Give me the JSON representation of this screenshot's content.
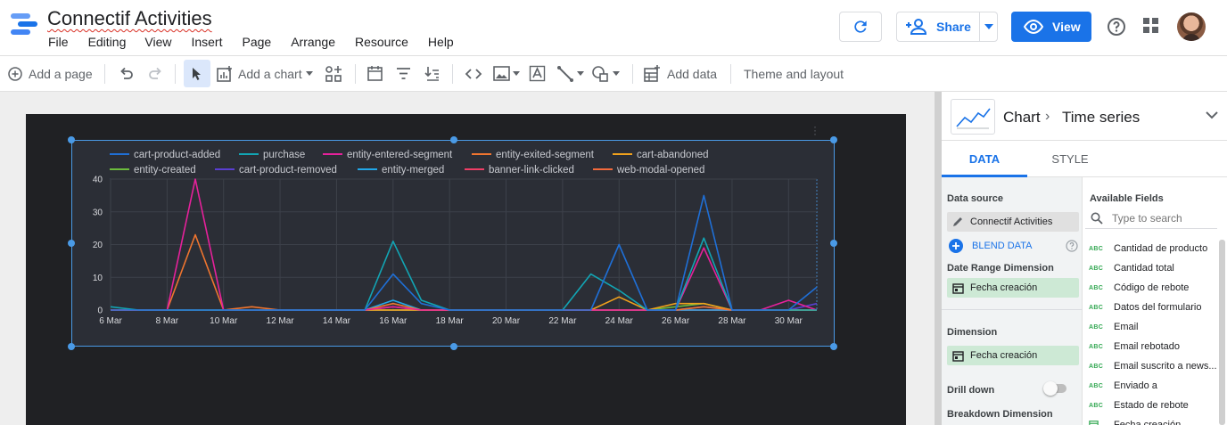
{
  "app": {
    "title": "Connectif Activities",
    "menu": [
      "File",
      "Editing",
      "View",
      "Insert",
      "Page",
      "Arrange",
      "Resource",
      "Help"
    ],
    "share_label": "Share",
    "view_label": "View",
    "brand_color": "#1a73e8"
  },
  "toolbar": {
    "add_page": "Add a page",
    "add_chart": "Add a chart",
    "add_data": "Add data",
    "theme_layout": "Theme and layout"
  },
  "panel": {
    "chart_label": "Chart",
    "chart_type": "Time series",
    "tabs": [
      "DATA",
      "STYLE"
    ],
    "data_source_label": "Data source",
    "data_source": "Connectif Activities",
    "blend_data": "BLEND DATA",
    "date_range_label": "Date Range Dimension",
    "date_range_value": "Fecha creación",
    "dimension_label": "Dimension",
    "dimension_value": "Fecha creación",
    "drill_down_label": "Drill down",
    "drill_down_on": false,
    "breakdown_label": "Breakdown Dimension",
    "available_fields_label": "Available Fields",
    "search_placeholder": "Type to search",
    "fields": [
      {
        "type": "ABC",
        "name": "Cantidad de producto"
      },
      {
        "type": "ABC",
        "name": "Cantidad total"
      },
      {
        "type": "ABC",
        "name": "Código de rebote"
      },
      {
        "type": "ABC",
        "name": "Datos del formulario"
      },
      {
        "type": "ABC",
        "name": "Email"
      },
      {
        "type": "ABC",
        "name": "Email rebotado"
      },
      {
        "type": "ABC",
        "name": "Email suscrito a news..."
      },
      {
        "type": "ABC",
        "name": "Enviado a"
      },
      {
        "type": "ABC",
        "name": "Estado de rebote"
      },
      {
        "type": "date",
        "name": "Fecha creación"
      }
    ]
  },
  "chart_data": {
    "type": "line",
    "x": [
      "6 Mar",
      "7 Mar",
      "8 Mar",
      "9 Mar",
      "10 Mar",
      "11 Mar",
      "12 Mar",
      "13 Mar",
      "14 Mar",
      "15 Mar",
      "16 Mar",
      "17 Mar",
      "18 Mar",
      "19 Mar",
      "20 Mar",
      "21 Mar",
      "22 Mar",
      "23 Mar",
      "24 Mar",
      "25 Mar",
      "26 Mar",
      "27 Mar",
      "28 Mar",
      "29 Mar",
      "30 Mar",
      "31 Mar"
    ],
    "x_tick_labels": [
      "6 Mar",
      "8 Mar",
      "10 Mar",
      "12 Mar",
      "14 Mar",
      "16 Mar",
      "18 Mar",
      "20 Mar",
      "22 Mar",
      "24 Mar",
      "26 Mar",
      "28 Mar",
      "30 Mar"
    ],
    "ylim": [
      0,
      40
    ],
    "y_ticks": [
      0,
      10,
      20,
      30,
      40
    ],
    "grid": true,
    "legend_position": "top",
    "series": [
      {
        "name": "cart-product-added",
        "color": "#1f6fd6",
        "values": [
          0,
          0,
          0,
          0,
          0,
          0,
          0,
          0,
          0,
          0,
          11,
          2,
          0,
          0,
          0,
          0,
          0,
          0,
          20,
          0,
          0,
          35,
          0,
          0,
          0,
          7
        ]
      },
      {
        "name": "purchase",
        "color": "#12a5b4",
        "values": [
          1,
          0,
          0,
          0,
          0,
          0,
          0,
          0,
          0,
          0,
          21,
          3,
          0,
          0,
          0,
          0,
          0,
          11,
          6,
          0,
          0,
          22,
          0,
          0,
          0,
          0
        ]
      },
      {
        "name": "entity-entered-segment",
        "color": "#e6219b",
        "values": [
          0,
          0,
          0,
          40,
          0,
          0,
          0,
          0,
          0,
          0,
          1,
          0,
          0,
          0,
          0,
          0,
          0,
          0,
          0,
          0,
          0,
          19,
          0,
          0,
          3,
          0
        ]
      },
      {
        "name": "entity-exited-segment",
        "color": "#f0752f",
        "values": [
          0,
          0,
          0,
          23,
          0,
          1,
          0,
          0,
          0,
          0,
          2,
          0,
          0,
          0,
          0,
          0,
          0,
          0,
          0,
          0,
          0,
          1,
          0,
          0,
          0,
          0
        ]
      },
      {
        "name": "cart-abandoned",
        "color": "#f0a11c",
        "values": [
          0,
          0,
          0,
          0,
          0,
          0,
          0,
          0,
          0,
          0,
          0,
          0,
          0,
          0,
          0,
          0,
          0,
          0,
          4,
          0,
          2,
          2,
          0,
          0,
          0,
          0
        ]
      },
      {
        "name": "entity-created",
        "color": "#6cbb3c",
        "values": [
          0,
          0,
          0,
          0,
          0,
          0,
          0,
          0,
          0,
          0,
          0,
          0,
          0,
          0,
          0,
          0,
          0,
          0,
          0,
          0,
          1,
          2,
          0,
          0,
          0,
          0
        ]
      },
      {
        "name": "cart-product-removed",
        "color": "#5a3fd1",
        "values": [
          0,
          0,
          0,
          0,
          0,
          0,
          0,
          0,
          0,
          0,
          0,
          0,
          0,
          0,
          0,
          0,
          0,
          0,
          0,
          0,
          0,
          1,
          0,
          0,
          0,
          2
        ]
      },
      {
        "name": "entity-merged",
        "color": "#22a7e8",
        "values": [
          0,
          0,
          0,
          0,
          0,
          0,
          0,
          0,
          0,
          0,
          3,
          0,
          0,
          0,
          0,
          0,
          0,
          0,
          0,
          0,
          0,
          0,
          0,
          0,
          0,
          0
        ]
      },
      {
        "name": "banner-link-clicked",
        "color": "#ef3e66",
        "values": [
          0,
          0,
          0,
          0,
          0,
          0,
          0,
          0,
          0,
          0,
          1,
          0,
          0,
          0,
          0,
          0,
          0,
          0,
          0,
          0,
          0,
          0,
          0,
          0,
          0,
          0
        ]
      },
      {
        "name": "web-modal-opened",
        "color": "#f26a3c",
        "values": [
          0,
          0,
          0,
          0,
          0,
          0,
          0,
          0,
          0,
          0,
          0,
          0,
          0,
          0,
          0,
          0,
          0,
          0,
          0,
          0,
          0,
          0,
          0,
          0,
          0,
          0
        ]
      }
    ]
  }
}
